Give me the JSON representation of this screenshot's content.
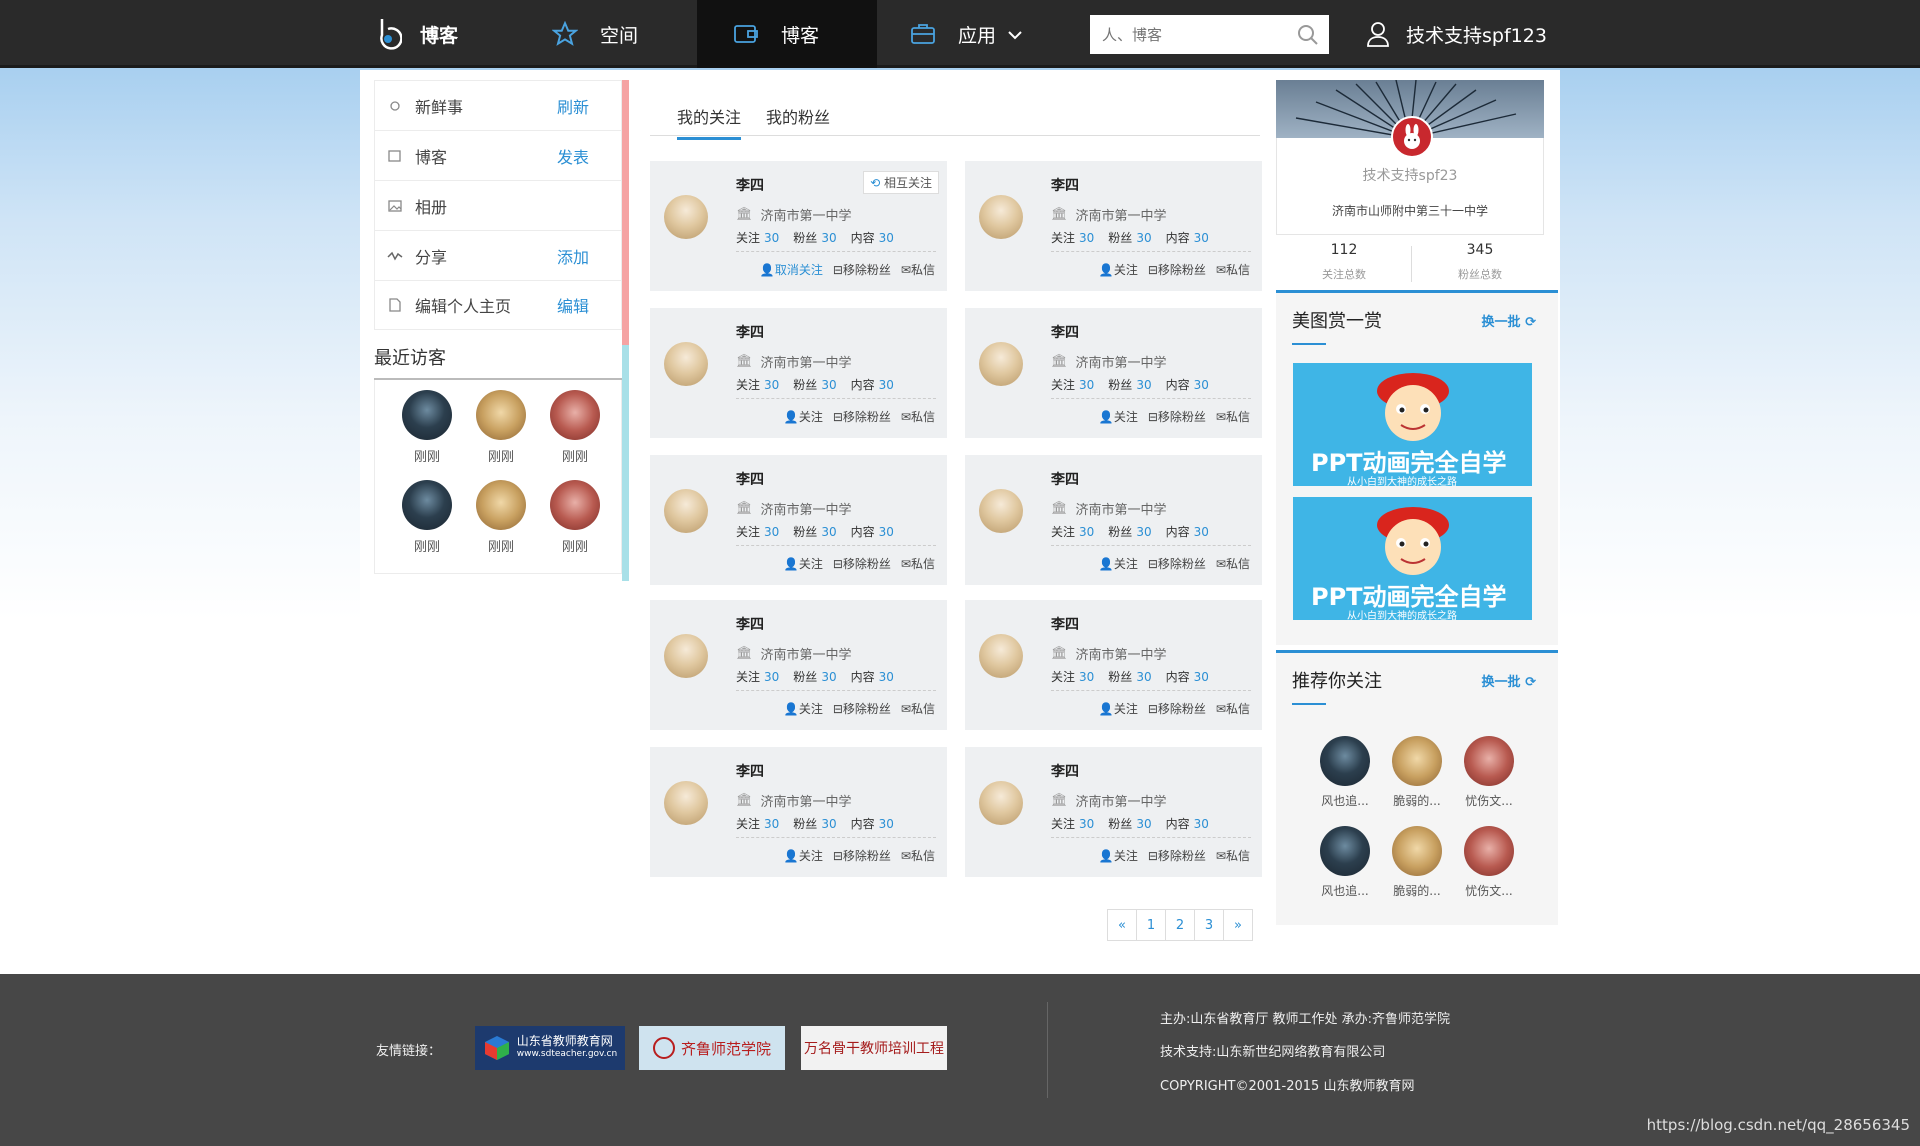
{
  "header": {
    "logo_text": "博客",
    "nav": [
      {
        "label": "空间"
      },
      {
        "label": "博客"
      },
      {
        "label": "应用"
      }
    ],
    "search_placeholder": "人、博客",
    "user": "技术支持spf123"
  },
  "left_menu": [
    {
      "label": "新鲜事",
      "action": "刷新",
      "icon": "sun-icon"
    },
    {
      "label": "博客",
      "action": "发表",
      "icon": "wallet-icon"
    },
    {
      "label": "相册",
      "action": "",
      "icon": "image-icon"
    },
    {
      "label": "分享",
      "action": "添加",
      "icon": "pulse-icon"
    },
    {
      "label": "编辑个人主页",
      "action": "编辑",
      "icon": "page-icon"
    }
  ],
  "visitors": {
    "title": "最近访客",
    "items": [
      {
        "name": "刚刚",
        "style": "dark"
      },
      {
        "name": "刚刚",
        "style": "gold"
      },
      {
        "name": "刚刚",
        "style": "red"
      },
      {
        "name": "刚刚",
        "style": "dark"
      },
      {
        "name": "刚刚",
        "style": "gold"
      },
      {
        "name": "刚刚",
        "style": "red"
      }
    ]
  },
  "tabs": [
    "我的关注",
    "我的粉丝"
  ],
  "card_labels": {
    "follow": "关注",
    "fans": "粉丝",
    "content": "内容",
    "mutual": "相互关注",
    "unfollow": "取消关注",
    "follow_action": "关注",
    "remove_fan": "移除粉丝",
    "message": "私信"
  },
  "cards": [
    {
      "name": "李四",
      "school": "济南市第一中学",
      "follow": "30",
      "fans": "30",
      "content": "30",
      "mutual": true
    },
    {
      "name": "李四",
      "school": "济南市第一中学",
      "follow": "30",
      "fans": "30",
      "content": "30",
      "mutual": false
    },
    {
      "name": "李四",
      "school": "济南市第一中学",
      "follow": "30",
      "fans": "30",
      "content": "30",
      "mutual": false
    },
    {
      "name": "李四",
      "school": "济南市第一中学",
      "follow": "30",
      "fans": "30",
      "content": "30",
      "mutual": false
    },
    {
      "name": "李四",
      "school": "济南市第一中学",
      "follow": "30",
      "fans": "30",
      "content": "30",
      "mutual": false
    },
    {
      "name": "李四",
      "school": "济南市第一中学",
      "follow": "30",
      "fans": "30",
      "content": "30",
      "mutual": false
    },
    {
      "name": "李四",
      "school": "济南市第一中学",
      "follow": "30",
      "fans": "30",
      "content": "30",
      "mutual": false
    },
    {
      "name": "李四",
      "school": "济南市第一中学",
      "follow": "30",
      "fans": "30",
      "content": "30",
      "mutual": false
    },
    {
      "name": "李四",
      "school": "济南市第一中学",
      "follow": "30",
      "fans": "30",
      "content": "30",
      "mutual": false
    },
    {
      "name": "李四",
      "school": "济南市第一中学",
      "follow": "30",
      "fans": "30",
      "content": "30",
      "mutual": false
    }
  ],
  "pagination": [
    "«",
    "1",
    "2",
    "3",
    "»"
  ],
  "profile": {
    "name": "技术支持spf23",
    "school": "济南市山师附中第三十一中学",
    "follow_count": "112",
    "follow_label": "关注总数",
    "fans_count": "345",
    "fans_label": "粉丝总数"
  },
  "gallery": {
    "title": "美图赏一赏",
    "more": "换一批",
    "banner_title": "PPT动画完全自学",
    "banner_sub": "从小白到大神的成长之路"
  },
  "recommend": {
    "title": "推荐你关注",
    "more": "换一批",
    "items": [
      {
        "name": "风也追...",
        "style": "dark"
      },
      {
        "name": "脆弱的...",
        "style": "gold"
      },
      {
        "name": "忧伤文...",
        "style": "red"
      },
      {
        "name": "风也追...",
        "style": "dark"
      },
      {
        "name": "脆弱的...",
        "style": "gold"
      },
      {
        "name": "忧伤文...",
        "style": "red"
      }
    ]
  },
  "footer": {
    "links_label": "友情链接：",
    "link1": "山东省教师教育网",
    "link1_sub": "www.sdteacher.gov.cn",
    "link2": "齐鲁师范学院",
    "link3": "万名骨干教师培训工程",
    "line1": "主办:山东省教育厅 教师工作处   承办:齐鲁师范学院",
    "line2": "技术支持:山东新世纪网络教育有限公司",
    "line3": "COPYRIGHT©2001-2015 山东教师教育网"
  },
  "watermark": "https://blog.csdn.net/qq_28656345",
  "colors": {
    "accent": "#2b8fd4",
    "topbar": "#2a2a2a",
    "footer": "#474747"
  }
}
